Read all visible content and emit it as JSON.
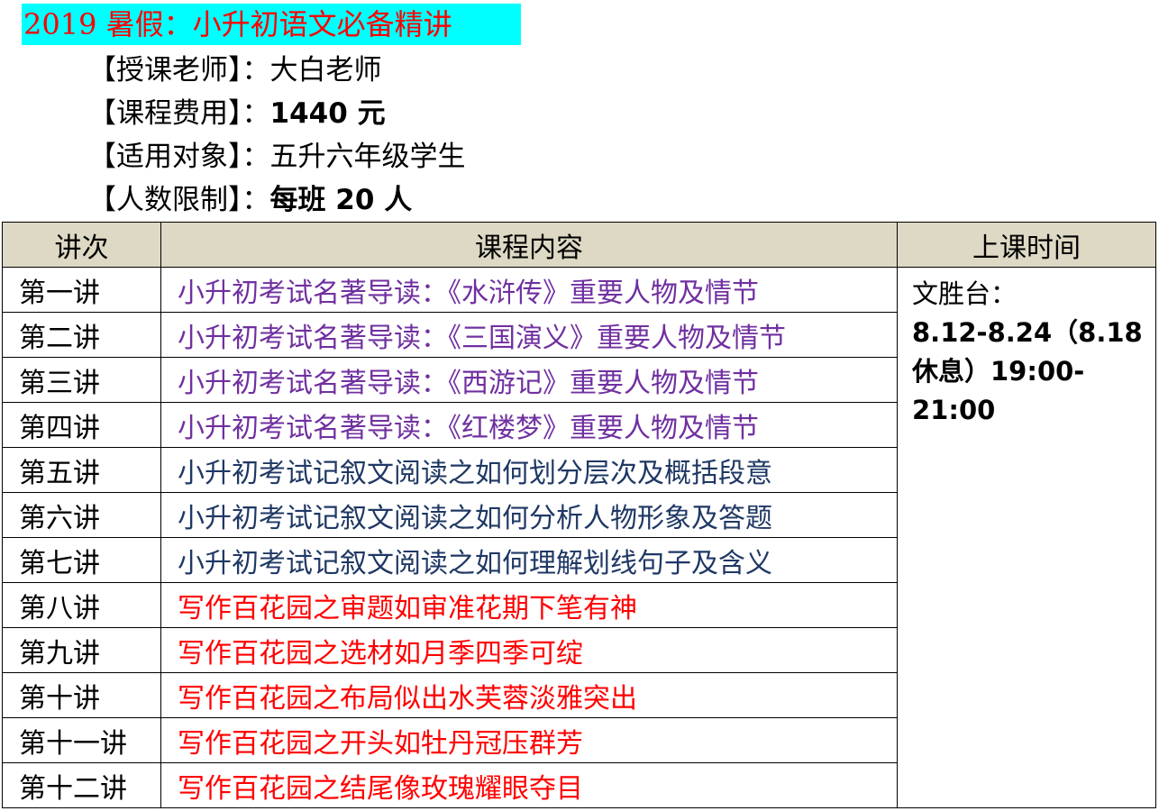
{
  "title": "2019 暑假：小升初语文必备精讲",
  "info": [
    {
      "label": "【授课老师】：",
      "value": "大白老师",
      "bold": false
    },
    {
      "label": "【课程费用】：",
      "value": "1440 元",
      "bold": true
    },
    {
      "label": "【适用对象】：",
      "value": "五升六年级学生",
      "bold": false
    },
    {
      "label": "【人数限制】：",
      "value": "每班 20 人",
      "bold": true
    }
  ],
  "table": {
    "headers": [
      "讲次",
      "课程内容",
      "上课时间"
    ],
    "rows": [
      {
        "lecture": "第一讲",
        "content": "小升初考试名著导读：《水浒传》重要人物及情节",
        "color": "#7030a0"
      },
      {
        "lecture": "第二讲",
        "content": "小升初考试名著导读：《三国演义》重要人物及情节",
        "color": "#7030a0"
      },
      {
        "lecture": "第三讲",
        "content": "小升初考试名著导读：《西游记》重要人物及情节",
        "color": "#7030a0"
      },
      {
        "lecture": "第四讲",
        "content": "小升初考试名著导读：《红楼梦》重要人物及情节",
        "color": "#7030a0"
      },
      {
        "lecture": "第五讲",
        "content": "小升初考试记叙文阅读之如何划分层次及概括段意",
        "color": "#1f3864"
      },
      {
        "lecture": "第六讲",
        "content": "小升初考试记叙文阅读之如何分析人物形象及答题",
        "color": "#1f3864"
      },
      {
        "lecture": "第七讲",
        "content": "小升初考试记叙文阅读之如何理解划线句子及含义",
        "color": "#1f3864"
      },
      {
        "lecture": "第八讲",
        "content": "写作百花园之审题如审准花期下笔有神",
        "color": "#ff0000"
      },
      {
        "lecture": "第九讲",
        "content": "写作百花园之选材如月季四季可绽",
        "color": "#ff0000"
      },
      {
        "lecture": "第十讲",
        "content": "写作百花园之布局似出水芙蓉淡雅突出",
        "color": "#ff0000"
      },
      {
        "lecture": "第十一讲",
        "content": "写作百花园之开头如牡丹冠压群芳",
        "color": "#ff0000"
      },
      {
        "lecture": "第十二讲",
        "content": "写作百花园之结尾像玫瑰耀眼夺目",
        "color": "#ff0000"
      }
    ],
    "time": {
      "location": "文胜台：",
      "dates": "8.12-8.24（8.18 休息）19:00-21:00"
    }
  },
  "colors": {
    "title_bg": "#00ffff",
    "title_text": "#ff0000",
    "header_bg": "#ddd9c4",
    "purple": "#7030a0",
    "navy": "#1f3864",
    "red": "#ff0000"
  }
}
